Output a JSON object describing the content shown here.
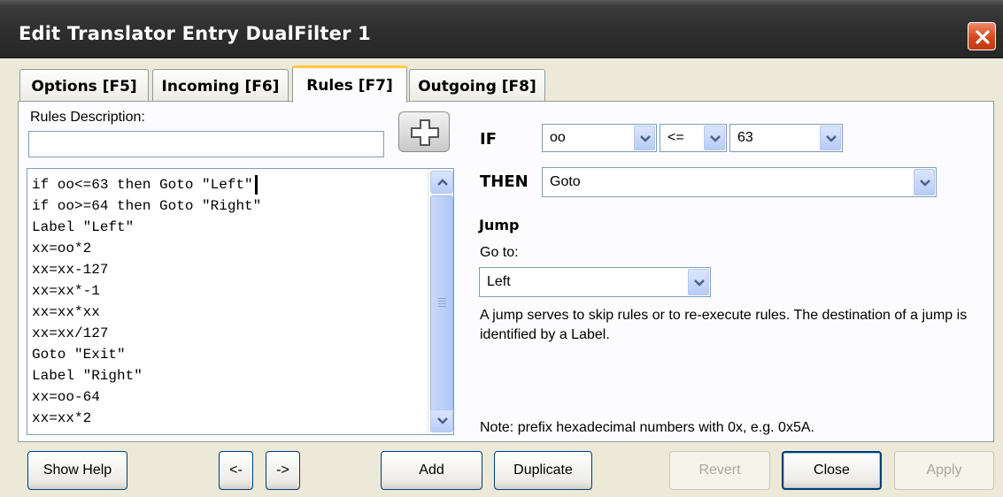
{
  "window": {
    "title": "Edit Translator Entry DualFilter 1"
  },
  "tabs": [
    {
      "label": "Options [F5]",
      "active": false
    },
    {
      "label": "Incoming [F6]",
      "active": false
    },
    {
      "label": "Rules [F7]",
      "active": true
    },
    {
      "label": "Outgoing [F8]",
      "active": false
    }
  ],
  "rules": {
    "description_label": "Rules Description:",
    "description_value": "",
    "lines": [
      "if oo<=63 then Goto \"Left\"",
      "if oo>=64 then Goto \"Right\"",
      "Label \"Left\"",
      "xx=oo*2",
      "xx=xx-127",
      "xx=xx*-1",
      "xx=xx*xx",
      "xx=xx/127",
      "Goto \"Exit\"",
      "Label \"Right\"",
      "xx=oo-64",
      "xx=xx*2"
    ]
  },
  "editor": {
    "if_label": "IF",
    "if_variable": "oo",
    "if_operator": "<=",
    "if_value": "63",
    "then_label": "THEN",
    "then_action": "Goto",
    "section_title": "Jump",
    "goto_label": "Go to:",
    "goto_target": "Left",
    "description": "A jump serves to skip rules or to re-execute rules. The destination of  a jump is identified by a Label.",
    "note": "Note: prefix hexadecimal numbers with 0x, e.g. 0x5A."
  },
  "buttons": {
    "show_help": "Show Help",
    "prev": "<-",
    "next": "->",
    "add": "Add",
    "duplicate": "Duplicate",
    "revert": "Revert",
    "close": "Close",
    "apply": "Apply"
  },
  "colors": {
    "titlebar": "#2e2e2e",
    "close_button": "#d4481e",
    "active_tab_highlight": "#ffc83c",
    "window_background": "#ece9d8"
  }
}
